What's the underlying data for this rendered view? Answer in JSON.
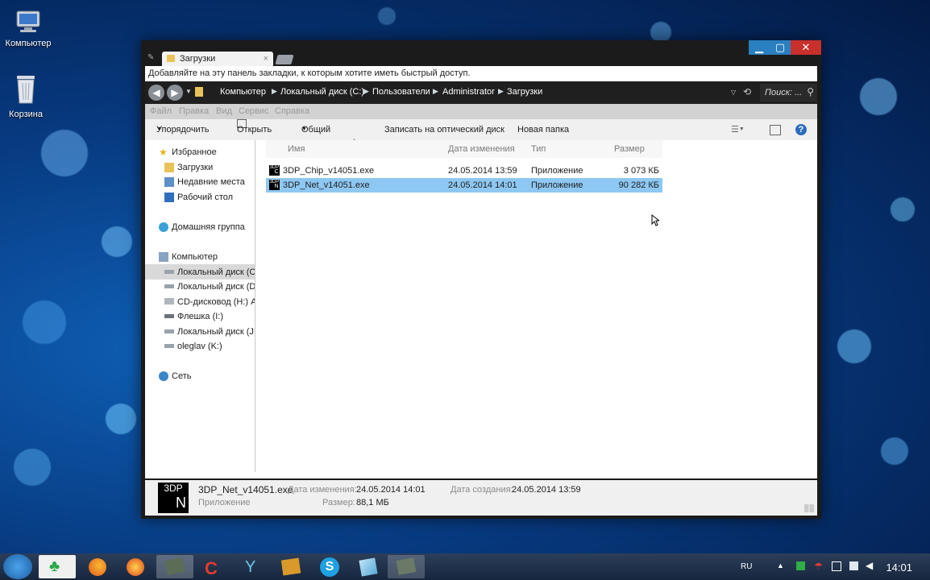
{
  "desktop": {
    "icons": [
      {
        "label": "Компьютер"
      },
      {
        "label": "Корзина"
      }
    ]
  },
  "window": {
    "tab_title": "Загрузки",
    "tab_close": "×",
    "bookmarks_hint": "Добавляйте на эту панель закладки, к которым хотите иметь быстрый доступ.",
    "controls": {
      "minimize": "▁",
      "maximize": "▢",
      "close": "✕"
    }
  },
  "breadcrumb": {
    "items": [
      "Компьютер",
      "Локальный диск (C:)",
      "Пользователи",
      "Administrator",
      "Загрузки"
    ],
    "search_placeholder": "Поиск: ..."
  },
  "menu": {
    "items": [
      "Файл",
      "Правка",
      "Вид",
      "Сервис",
      "Справка"
    ]
  },
  "toolbar": {
    "organize": "Упорядочить",
    "open": "Открыть",
    "share": "Общий доступ",
    "burn": "Записать на оптический диск",
    "new_folder": "Новая папка"
  },
  "navpane": {
    "favorites": "Избранное",
    "downloads": "Загрузки",
    "recent": "Недавние места",
    "desktop": "Рабочий стол",
    "homegroup": "Домашняя группа",
    "computer": "Компьютер",
    "drives": [
      "Локальный диск (C:)",
      "Локальный диск (D:)",
      "CD-дисковод (H:) Ac",
      "Флешка (I:)",
      "Локальный диск (J:)",
      "oleglav (K:)"
    ],
    "network": "Сеть"
  },
  "filelist": {
    "columns": [
      "Имя",
      "Дата изменения",
      "Тип",
      "Размер"
    ],
    "rows": [
      {
        "name": "3DP_Chip_v14051.exe",
        "date": "24.05.2014 13:59",
        "type": "Приложение",
        "size": "3 073 КБ",
        "icon_letter": "C"
      },
      {
        "name": "3DP_Net_v14051.exe",
        "date": "24.05.2014 14:01",
        "type": "Приложение",
        "size": "90 282 КБ",
        "icon_letter": "N"
      }
    ]
  },
  "details": {
    "icon_top": "3DP",
    "icon_letter": "N",
    "filename": "3DP_Net_v14051.exe",
    "type": "Приложение",
    "modified_label": "Дата изменения:",
    "modified_value": "24.05.2014 14:01",
    "size_label": "Размер:",
    "size_value": "88,1 МБ",
    "created_label": "Дата создания:",
    "created_value": "24.05.2014 13:59"
  },
  "taskbar": {
    "language": "RU",
    "clock": "14:01"
  },
  "colors": {
    "selection": "#8ec8f2",
    "navbar": "#1f1f1f"
  }
}
